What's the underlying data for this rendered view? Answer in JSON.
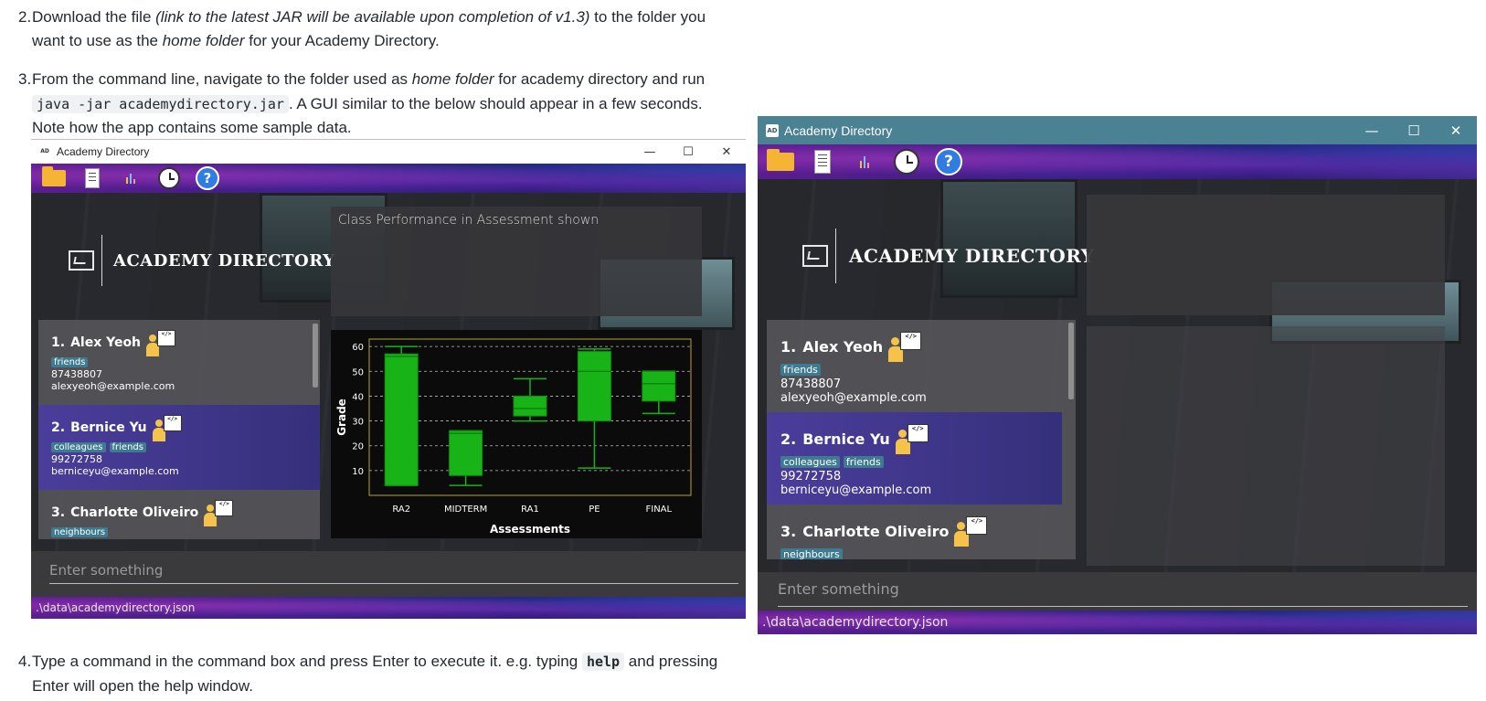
{
  "doc": {
    "step2": {
      "num": "2.",
      "line1_a": "Download the file ",
      "line1_em": "(link to the latest JAR will be available upon completion of v1.3)",
      "line1_b": " to the folder you",
      "line2_a": "want to use as the ",
      "line2_em": "home folder",
      "line2_b": " for your Academy Directory."
    },
    "step3": {
      "num": "3.",
      "line1_a": "From the command line, navigate to the folder used as ",
      "line1_em": "home folder",
      "line1_b": " for academy directory and run",
      "code": "java -jar academydirectory.jar",
      "line2_b": ". A GUI similar to the below should appear in a few seconds.",
      "line3": "Note how the app contains some sample data."
    },
    "step4": {
      "num": "4.",
      "line1_a": "Type a command in the command box and press Enter to execute it. e.g. typing ",
      "code": "help",
      "line1_b": " and pressing",
      "line2": "Enter will open the help window."
    }
  },
  "app": {
    "window_title": "Academy Directory",
    "title_logo": "AD",
    "controls": {
      "minimize": "—",
      "maximize": "☐",
      "close": "✕"
    },
    "toolbar_icons": [
      "folder-icon",
      "document-icon",
      "bar-chart-icon",
      "clock-icon",
      "help-icon"
    ],
    "help_glyph": "?",
    "logo_text": "ACADEMY DIRECTORY",
    "result_text": "Class Performance in Assessment shown",
    "command_placeholder": "Enter something",
    "status_path": ".\\data\\academydirectory.json",
    "persons": [
      {
        "index": "1.",
        "name": "Alex Yeoh",
        "tags": [
          "friends"
        ],
        "phone": "87438807",
        "email": "alexyeoh@example.com"
      },
      {
        "index": "2.",
        "name": "Bernice Yu",
        "tags": [
          "colleagues",
          "friends"
        ],
        "phone": "99272758",
        "email": "berniceyu@example.com"
      },
      {
        "index": "3.",
        "name": "Charlotte Oliveiro",
        "tags": [
          "neighbours"
        ],
        "phone": "",
        "email": ""
      }
    ]
  },
  "colors": {
    "accent": "#3e7b91",
    "title_bar": "#4a8294",
    "box_fill": "#17b317",
    "box_stroke": "#0f8f0f",
    "plot_border": "#b3a42a"
  },
  "chart_data": {
    "type": "box",
    "title": "",
    "xlabel": "Assessments",
    "ylabel": "Grade",
    "ylim": [
      0,
      63
    ],
    "yticks": [
      10,
      20,
      30,
      40,
      50,
      60
    ],
    "categories": [
      "RA2",
      "MIDTERM",
      "RA1",
      "PE",
      "FINAL"
    ],
    "boxes": [
      {
        "category": "RA2",
        "min": 4,
        "q1": 4,
        "median": 56,
        "q3": 57,
        "max": 60
      },
      {
        "category": "MIDTERM",
        "min": 4,
        "q1": 8,
        "median": 25,
        "q3": 26,
        "max": 26
      },
      {
        "category": "RA1",
        "min": 30,
        "q1": 32,
        "median": 35,
        "q3": 40,
        "max": 47
      },
      {
        "category": "PE",
        "min": 11,
        "q1": 30,
        "median": 50,
        "q3": 58,
        "max": 59
      },
      {
        "category": "FINAL",
        "min": 33,
        "q1": 38,
        "median": 45,
        "q3": 50,
        "max": 50
      }
    ],
    "grid": true,
    "legend": "none"
  }
}
